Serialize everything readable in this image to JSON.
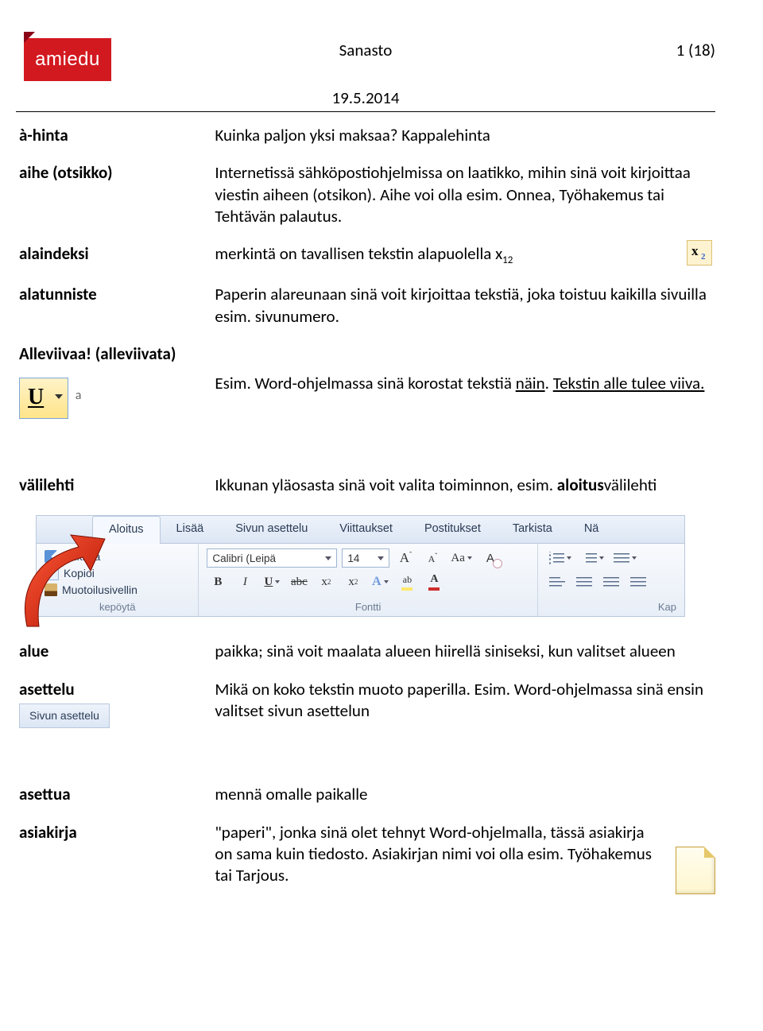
{
  "header": {
    "logo_text": "amiedu",
    "center_title": "Sanasto",
    "page_number": "1 (18)",
    "date": "19.5.2014"
  },
  "entries": {
    "a_hinta": {
      "term": "à-hinta",
      "def": "Kuinka paljon yksi maksaa? Kappalehinta"
    },
    "aihe": {
      "term": "aihe (otsikko)",
      "def": "Internetissä sähköpostiohjelmissa on laatikko, mihin sinä voit kirjoittaa viestin aiheen (otsikon). Aihe voi olla esim. Onnea, Työhakemus tai Tehtävän palautus."
    },
    "alaindeksi": {
      "term": "alaindeksi",
      "def_pre": "merkintä on tavallisen tekstin alapuolella x",
      "def_sub": "12"
    },
    "alatunniste": {
      "term": "alatunniste",
      "def": "Paperin alareunaan sinä voit kirjoittaa tekstiä, joka toistuu kaikilla sivuilla esim. sivunumero."
    },
    "alleviivaa": {
      "term": "Alleviivaa! (alleviivata)",
      "def_pre": "Esim. Word-ohjelmassa sinä korostat tekstiä ",
      "def_u1": "näin",
      "def_mid": ". ",
      "def_u2": "Tekstin alle tulee viiva."
    },
    "valilehti": {
      "term": "välilehti",
      "def_pre": "Ikkunan yläosasta sinä voit valita toiminnon, esim. ",
      "def_bold": "aloitus",
      "def_post": "välilehti"
    },
    "alue": {
      "term": "alue",
      "def": "paikka; sinä voit maalata alueen hiirellä siniseksi, kun valitset alueen"
    },
    "asettelu": {
      "term": "asettelu",
      "def": "Mikä on koko tekstin muoto paperilla. Esim. Word-ohjelmassa sinä ensin valitset sivun asettelun",
      "tab_label": "Sivun asettelu"
    },
    "asettua": {
      "term": "asettua",
      "def": "mennä omalle paikalle"
    },
    "asiakirja": {
      "term": "asiakirja",
      "def": "\"paperi\", jonka sinä olet tehnyt Word-ohjelmalla, tässä asiakirja on sama kuin tiedosto. Asiakirjan nimi voi olla esim. Työhakemus tai Tarjous."
    }
  },
  "ribbon": {
    "tabs": [
      "Aloitus",
      "Lisää",
      "Sivun asettelu",
      "Viittaukset",
      "Postitukset",
      "Tarkista",
      "Nä"
    ],
    "clipboard": {
      "cut": "Leikkaa",
      "copy": "Kopioi",
      "brush": "Muotoilusivellin",
      "group": "kepöytä"
    },
    "font": {
      "name": "Calibri (Leipä",
      "size": "14",
      "group": "Fontti"
    },
    "para_group": "Kap"
  }
}
